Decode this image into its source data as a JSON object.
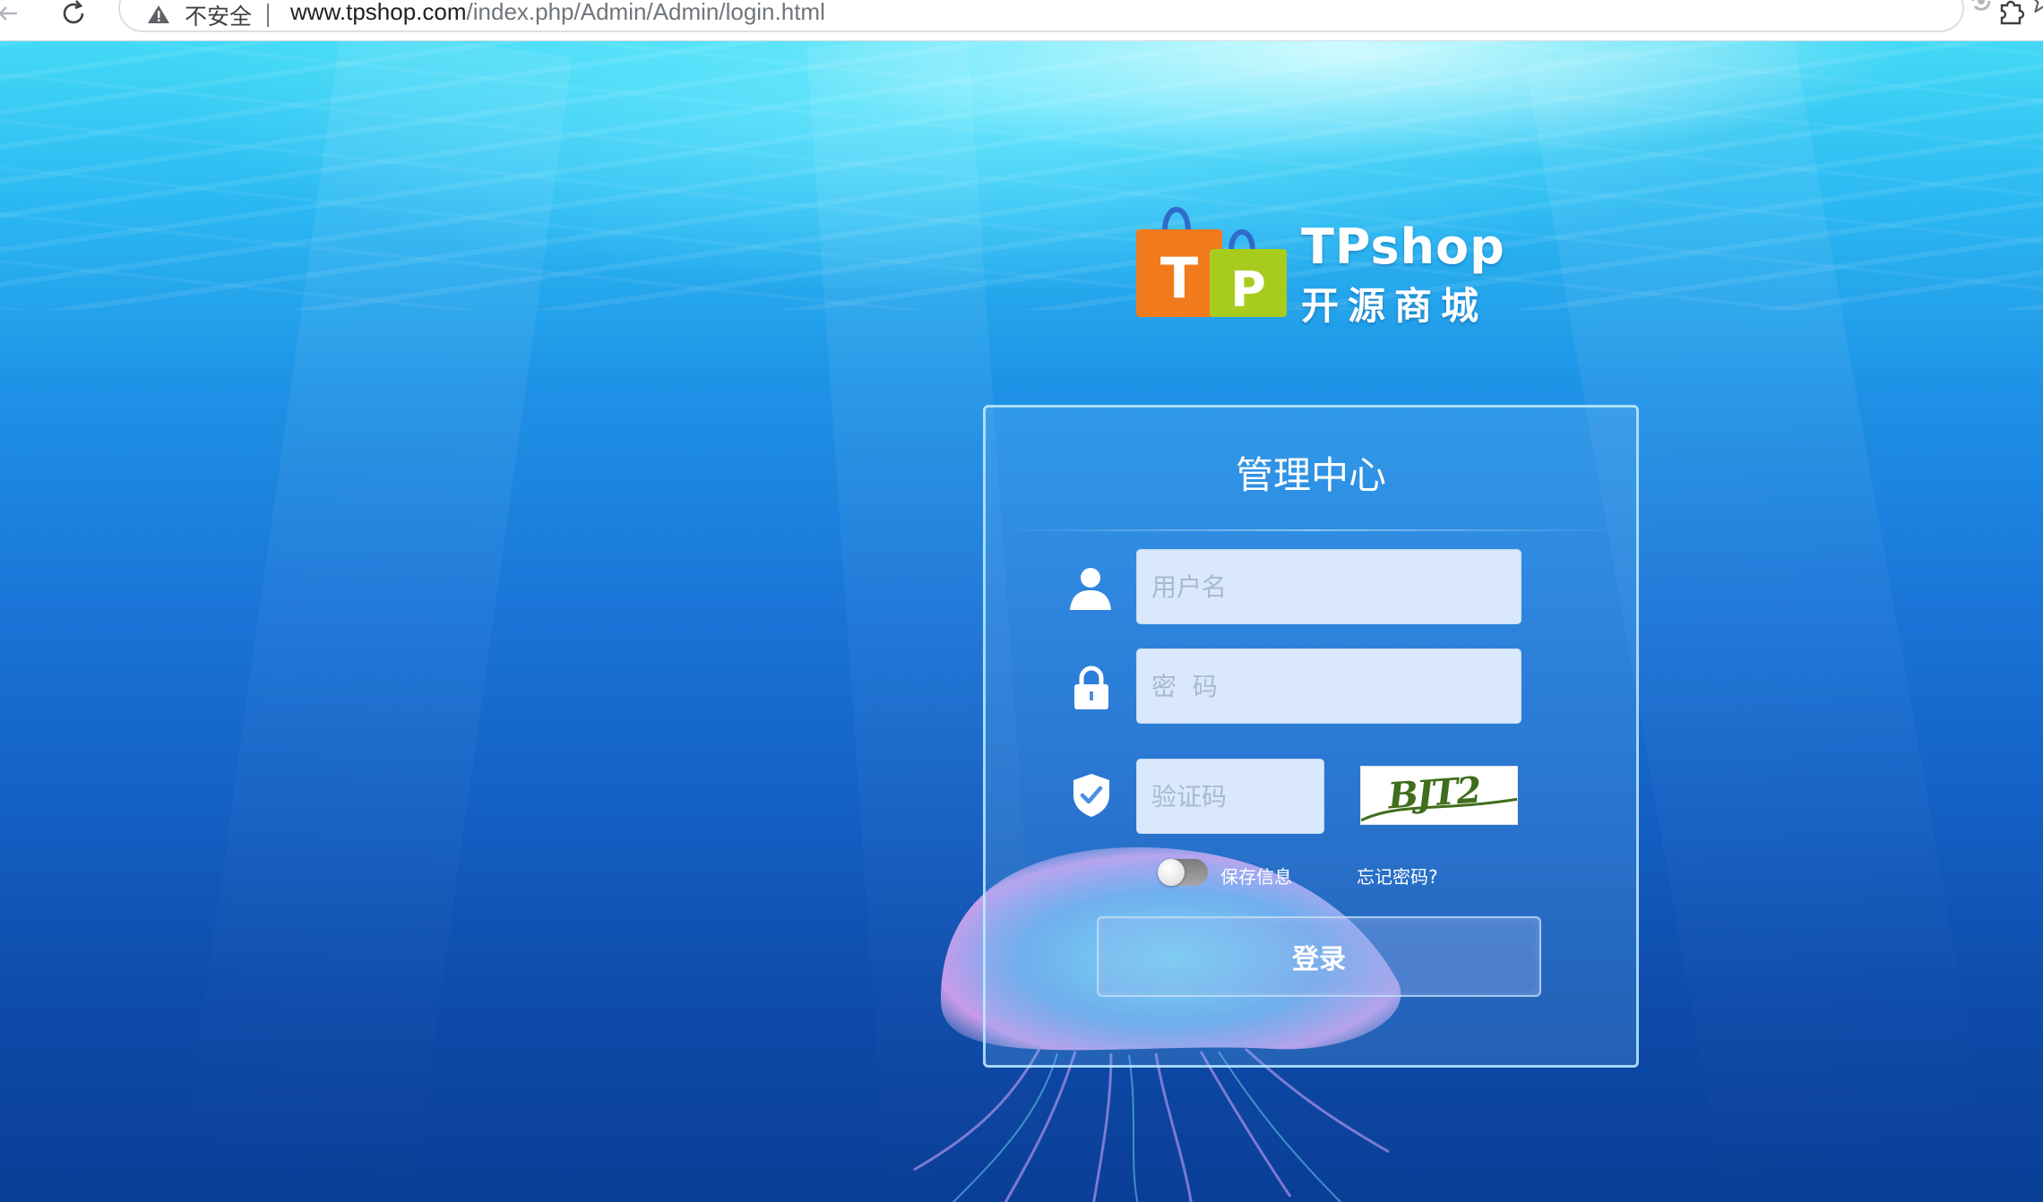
{
  "browser": {
    "security_label": "不安全",
    "url_host": "www.tpshop.com",
    "url_path": "/index.php/Admin/Admin/login.html",
    "icons": [
      "back-arrow-icon",
      "reload-icon",
      "warning-icon",
      "collections-icon",
      "star-icon",
      "extensions-icon"
    ]
  },
  "logo": {
    "title_en": "TPshop",
    "title_cn": "开源商城",
    "bag_letters": [
      "T",
      "P"
    ]
  },
  "login": {
    "title": "管理中心",
    "username_placeholder": "用户名",
    "password_placeholder": "密  码",
    "captcha_placeholder": "验证码",
    "captcha_text": "BJT2",
    "remember_label": "保存信息",
    "remember_checked": false,
    "forgot_label": "忘记密码?",
    "submit_label": "登录"
  },
  "colors": {
    "panel_border": "#beebff",
    "field_bg": "#d9e8fb",
    "captcha_ink": "#3f6e1c",
    "bag_orange": "#f07a1c",
    "bag_green": "#a8cc1e"
  }
}
